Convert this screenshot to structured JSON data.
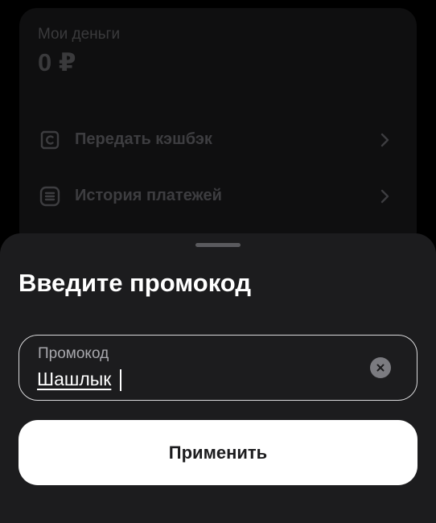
{
  "background": {
    "money_label": "Мои деньги",
    "money_value": "0 ₽",
    "menu_items": [
      {
        "label": "Передать кэшбэк",
        "icon": "cashback-transfer-icon"
      },
      {
        "label": "История платежей",
        "icon": "payment-history-icon"
      }
    ]
  },
  "sheet": {
    "title": "Введите промокод",
    "promo_field": {
      "label": "Промокод",
      "value": "Шашлык"
    },
    "apply_label": "Применить"
  },
  "colors": {
    "sheet_bg": "#1c1c1e",
    "button_bg": "#ffffff",
    "dimmed_text": "#3d3d40",
    "field_border": "#d9d9db"
  }
}
